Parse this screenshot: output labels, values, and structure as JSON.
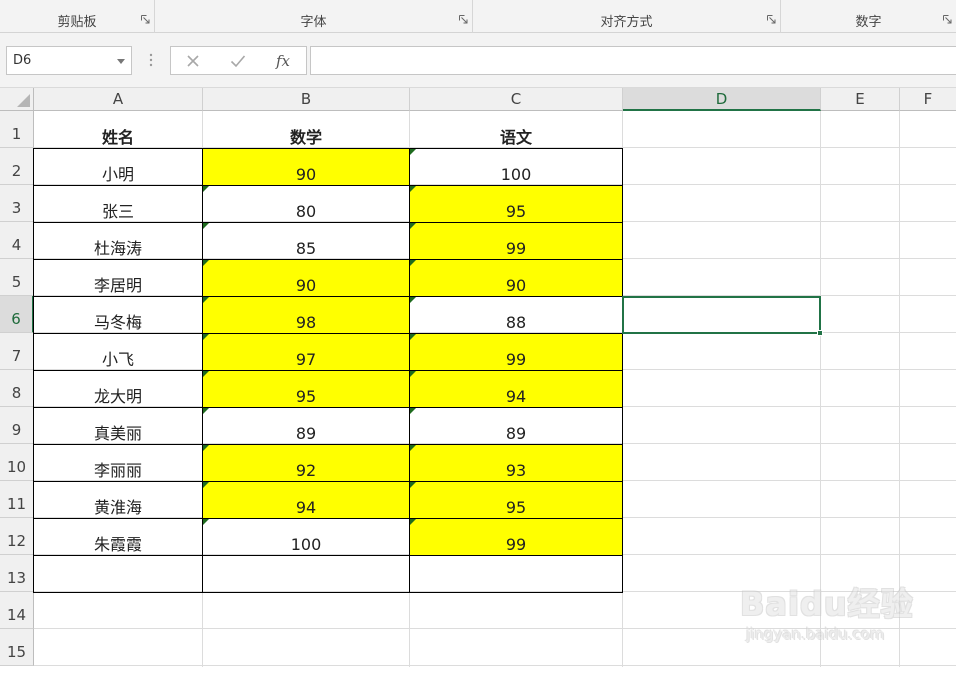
{
  "ribbon": {
    "groups": [
      {
        "label": "剪贴板"
      },
      {
        "label": "字体"
      },
      {
        "label": "对齐方式"
      },
      {
        "label": "数字"
      }
    ]
  },
  "formula_bar": {
    "name_box": "D6",
    "cancel_icon": "close-icon",
    "enter_icon": "check-icon",
    "fx_label": "fx",
    "formula": ""
  },
  "columns": [
    "A",
    "B",
    "C",
    "D",
    "E",
    "F"
  ],
  "rows": [
    "1",
    "2",
    "3",
    "4",
    "5",
    "6",
    "7",
    "8",
    "9",
    "10",
    "11",
    "12",
    "13",
    "14",
    "15"
  ],
  "selected_cell": "D6",
  "colors": {
    "highlight": "#ffff00",
    "accent": "#217346",
    "error_flag": "#1e6b1e"
  },
  "table": {
    "headers": [
      "姓名",
      "数学",
      "语文"
    ],
    "rows": [
      {
        "name": "小明",
        "math": "90",
        "chinese": "100",
        "math_hl": true,
        "chinese_hl": false
      },
      {
        "name": "张三",
        "math": "80",
        "chinese": "95",
        "math_hl": false,
        "chinese_hl": true
      },
      {
        "name": "杜海涛",
        "math": "85",
        "chinese": "99",
        "math_hl": false,
        "chinese_hl": true
      },
      {
        "name": "李居明",
        "math": "90",
        "chinese": "90",
        "math_hl": true,
        "chinese_hl": true
      },
      {
        "name": "马冬梅",
        "math": "98",
        "chinese": "88",
        "math_hl": true,
        "chinese_hl": false
      },
      {
        "name": "小飞",
        "math": "97",
        "chinese": "99",
        "math_hl": true,
        "chinese_hl": true
      },
      {
        "name": "龙大明",
        "math": "95",
        "chinese": "94",
        "math_hl": true,
        "chinese_hl": true
      },
      {
        "name": "真美丽",
        "math": "89",
        "chinese": "89",
        "math_hl": false,
        "chinese_hl": false
      },
      {
        "name": "李丽丽",
        "math": "92",
        "chinese": "93",
        "math_hl": true,
        "chinese_hl": true
      },
      {
        "name": "黄淮海",
        "math": "94",
        "chinese": "95",
        "math_hl": true,
        "chinese_hl": true
      },
      {
        "name": "朱霞霞",
        "math": "100",
        "chinese": "99",
        "math_hl": false,
        "chinese_hl": true
      }
    ]
  },
  "watermark": {
    "brand": "Baidu经验",
    "url": "jingyan.baidu.com"
  }
}
